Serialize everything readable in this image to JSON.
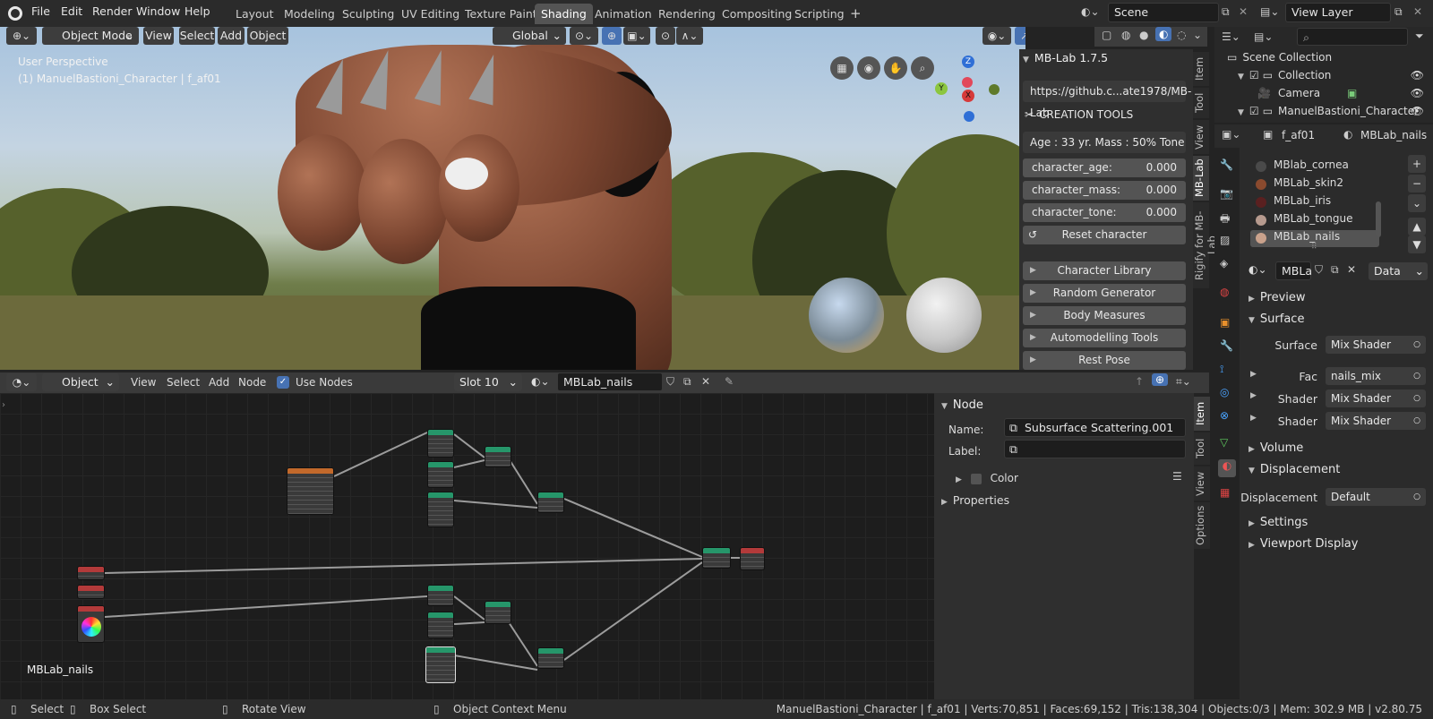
{
  "menus": [
    "File",
    "Edit",
    "Render",
    "Window",
    "Help"
  ],
  "workspace_tabs": [
    "Layout",
    "Modeling",
    "Sculpting",
    "UV Editing",
    "Texture Paint",
    "Shading",
    "Animation",
    "Rendering",
    "Compositing",
    "Scripting"
  ],
  "active_tab": "Shading",
  "scene": {
    "label": "Scene",
    "view_layer": "View Layer"
  },
  "viewport": {
    "mode": "Object Mode",
    "menus": [
      "View",
      "Select",
      "Add",
      "Object"
    ],
    "transform": "Global",
    "overlay_line1": "User Perspective",
    "overlay_line2": "(1) ManuelBastioni_Character | f_af01",
    "axes": {
      "z": "Z",
      "y": "Y",
      "x": "X"
    }
  },
  "npanel": {
    "title": "MB-Lab 1.7.5",
    "url": "https://github.c...ate1978/MB-Lab",
    "creation_tools": "CREATION TOOLS",
    "summary": "Age : 33 yr.  Mass : 50%  Tone : ...",
    "sliders": [
      {
        "label": "character_age:",
        "value": "0.000"
      },
      {
        "label": "character_mass:",
        "value": "0.000"
      },
      {
        "label": "character_tone:",
        "value": "0.000"
      }
    ],
    "reset": "Reset character",
    "sections": [
      "Character Library",
      "Random Generator",
      "Body Measures",
      "Automodelling Tools",
      "Rest Pose"
    ],
    "side_tabs": [
      "Item",
      "Tool",
      "View",
      "MB-Lab",
      "Rigify for MB-Lab"
    ]
  },
  "node_editor": {
    "type": "Object",
    "menus": [
      "View",
      "Select",
      "Add",
      "Node"
    ],
    "use_nodes": "Use Nodes",
    "slot": "Slot 10",
    "material": "MBLab_nails",
    "canvas_label": "MBLab_nails",
    "side_panel": {
      "header": "Node",
      "name_label": "Name:",
      "name_value": "Subsurface Scattering.001",
      "label_label": "Label:",
      "color_label": "Color",
      "properties_label": "Properties"
    },
    "side_tabs": [
      "Item",
      "Tool",
      "View",
      "Options"
    ]
  },
  "outliner": {
    "scene_collection": "Scene Collection",
    "items": [
      {
        "name": "Collection",
        "indent": 1
      },
      {
        "name": "Camera",
        "indent": 2
      },
      {
        "name": "ManuelBastioni_Character",
        "indent": 1
      }
    ]
  },
  "properties": {
    "object": "f_af01",
    "material": "MBLab_nails",
    "material_slots": [
      "MBlab_cornea",
      "MBLab_skin2",
      "MBLab_iris",
      "MBLab_tongue",
      "MBLab_nails"
    ],
    "active_slot": 4,
    "slot_colors": [
      "#4a4a4a",
      "#8a4a2e",
      "#5a2020",
      "#b69a8e",
      "#caa28c"
    ],
    "material_short": "MBLa",
    "link": "Data",
    "sections": {
      "preview": "Preview",
      "surface": "Surface",
      "volume": "Volume",
      "displacement": "Displacement",
      "settings": "Settings",
      "viewport_display": "Viewport Display"
    },
    "surface_rows": [
      {
        "label": "Surface",
        "value": "Mix Shader"
      },
      {
        "label": "Fac",
        "value": "nails_mix"
      },
      {
        "label": "Shader",
        "value": "Mix Shader"
      },
      {
        "label": "Shader",
        "value": "Mix Shader"
      }
    ],
    "displacement_row": {
      "label": "Displacement",
      "value": "Default"
    }
  },
  "statusbar": {
    "select": "Select",
    "box_select": "Box Select",
    "rotate": "Rotate View",
    "context": "Object Context Menu",
    "info": "ManuelBastioni_Character | f_af01 | Verts:70,851 | Faces:69,152 | Tris:138,304 | Objects:0/3 | Mem: 302.9 MB | v2.80.75"
  }
}
